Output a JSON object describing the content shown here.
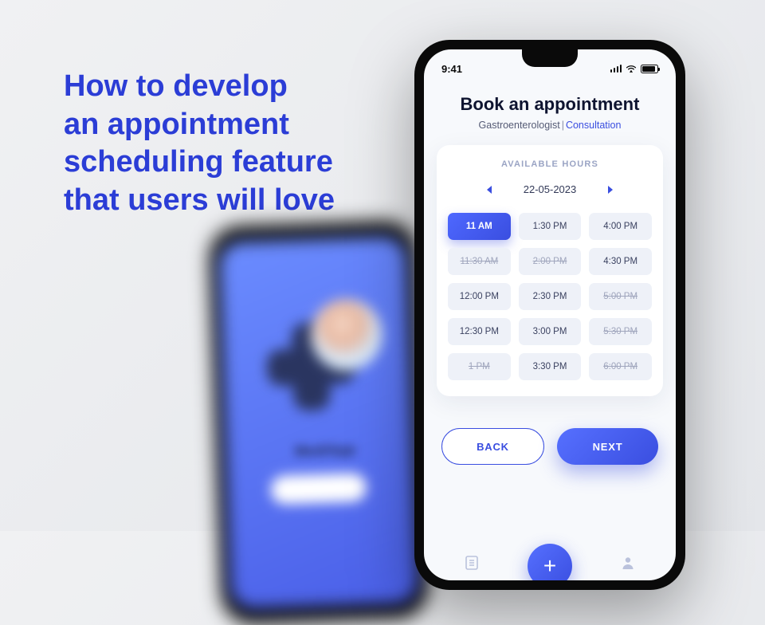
{
  "headline": "How to develop\nan appointment\nscheduling feature\nthat users will love",
  "bg_phone": {
    "app_name": "MediApp"
  },
  "phone": {
    "status": {
      "time": "9:41"
    },
    "title": "Book an appointment",
    "subtitle": {
      "specialty": "Gastroenterologist",
      "action": "Consultation"
    },
    "card": {
      "header": "AVAILABLE HOURS",
      "date": "22-05-2023",
      "slots": [
        {
          "label": "11 AM",
          "state": "selected"
        },
        {
          "label": "1:30 PM",
          "state": "available"
        },
        {
          "label": "4:00 PM",
          "state": "available"
        },
        {
          "label": "11:30 AM",
          "state": "unavailable"
        },
        {
          "label": "2:00 PM",
          "state": "unavailable"
        },
        {
          "label": "4:30 PM",
          "state": "available"
        },
        {
          "label": "12:00 PM",
          "state": "available"
        },
        {
          "label": "2:30 PM",
          "state": "available"
        },
        {
          "label": "5:00 PM",
          "state": "unavailable"
        },
        {
          "label": "12:30 PM",
          "state": "available"
        },
        {
          "label": "3:00 PM",
          "state": "available"
        },
        {
          "label": "5:30 PM",
          "state": "unavailable"
        },
        {
          "label": "1 PM",
          "state": "unavailable"
        },
        {
          "label": "3:30 PM",
          "state": "available"
        },
        {
          "label": "6:00 PM",
          "state": "unavailable"
        }
      ]
    },
    "actions": {
      "back": "BACK",
      "next": "NEXT"
    }
  }
}
